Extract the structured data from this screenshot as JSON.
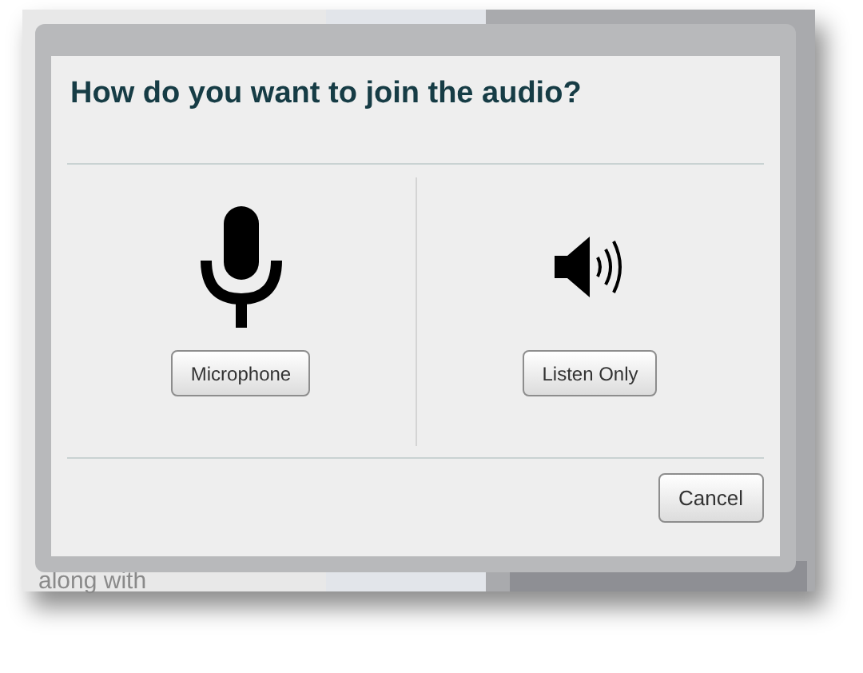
{
  "background": {
    "text": "along with"
  },
  "dialog": {
    "title": "How do you want to join the audio?",
    "options": [
      {
        "kind": "microphone",
        "label": "Microphone"
      },
      {
        "kind": "speaker",
        "label": "Listen Only"
      }
    ],
    "cancel": "Cancel"
  }
}
